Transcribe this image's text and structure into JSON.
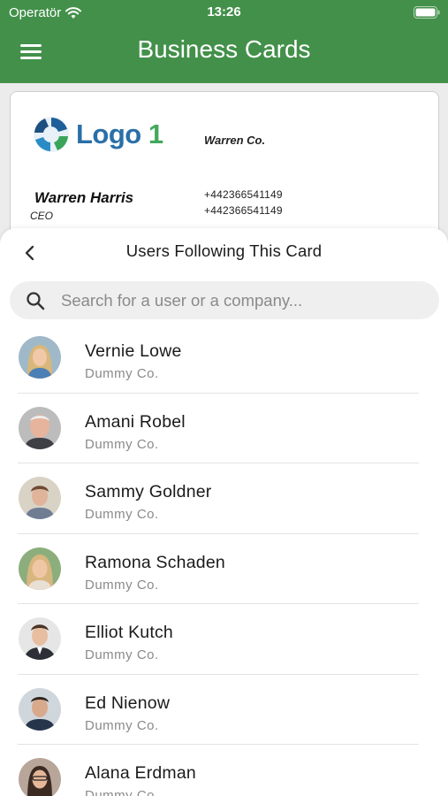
{
  "status_bar": {
    "carrier": "Operatör",
    "time": "13:26"
  },
  "header": {
    "title": "Business Cards",
    "menu_icon": "hamburger-menu-icon"
  },
  "card": {
    "logo_text_a": "Logo",
    "logo_text_b": "1",
    "company": "Warren Co.",
    "name": "Warren Harris",
    "title": "CEO",
    "phones": [
      "+442366541149",
      "+442366541149"
    ]
  },
  "sheet": {
    "title": "Users Following This Card",
    "back_icon": "chevron-left-icon",
    "search": {
      "placeholder": "Search for a user or a company...",
      "value": ""
    }
  },
  "users": [
    {
      "name": "Vernie Lowe",
      "company": "Dummy Co."
    },
    {
      "name": "Amani Robel",
      "company": "Dummy Co."
    },
    {
      "name": "Sammy Goldner",
      "company": "Dummy Co."
    },
    {
      "name": "Ramona Schaden",
      "company": "Dummy Co."
    },
    {
      "name": "Elliot Kutch",
      "company": "Dummy Co."
    },
    {
      "name": "Ed Nienow",
      "company": "Dummy Co."
    },
    {
      "name": "Alana Erdman",
      "company": "Dummy Co."
    }
  ],
  "colors": {
    "header": "#43904a",
    "logo_blue": "#2a6fa8",
    "logo_green": "#43a85b"
  }
}
